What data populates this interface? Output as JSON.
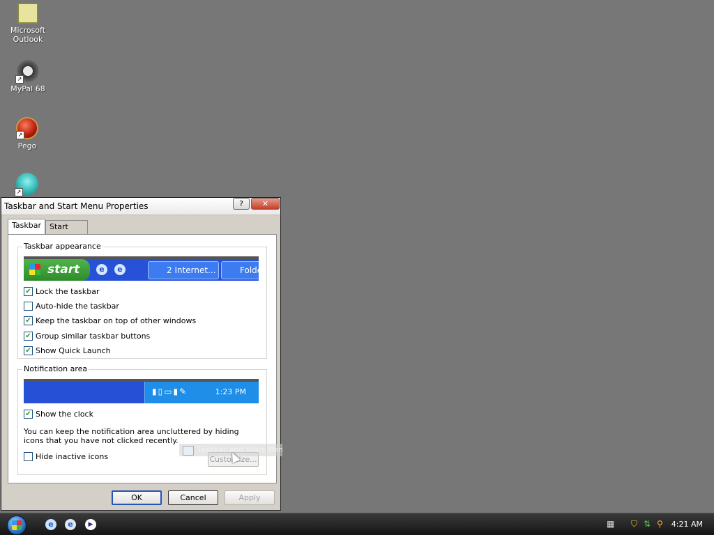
{
  "desktop": {
    "icons": [
      {
        "label": "Microsoft Outlook",
        "icon": "outlook-icon"
      },
      {
        "label": "MyPal 68",
        "icon": "mypal-raccoon-icon"
      },
      {
        "label": "Pego",
        "icon": "pego-icon"
      },
      {
        "label": "",
        "icon": "teal-app-icon"
      }
    ],
    "background_color": "#777777"
  },
  "dialog": {
    "title": "Taskbar and Start Menu Properties",
    "help_glyph": "?",
    "close_glyph": "✕",
    "tabs": [
      {
        "label": "Taskbar",
        "active": true
      },
      {
        "label": "Start Menu",
        "active": false
      }
    ],
    "taskbar_appearance": {
      "label": "Taskbar appearance",
      "preview": {
        "start_label": "start",
        "button1": "2 Internet...",
        "button2": "Folde"
      },
      "options": [
        {
          "label": "Lock the taskbar",
          "checked": true
        },
        {
          "label": "Auto-hide the taskbar",
          "checked": false
        },
        {
          "label": "Keep the taskbar on top of other windows",
          "checked": true
        },
        {
          "label": "Group similar taskbar buttons",
          "checked": true
        },
        {
          "label": "Show Quick Launch",
          "checked": true
        }
      ]
    },
    "notification_area": {
      "label": "Notification area",
      "preview_time": "1:23 PM",
      "show_clock": {
        "label": "Show the clock",
        "checked": true
      },
      "info_text": "You can keep the notification area uncluttered by hiding icons that you have not clicked recently.",
      "hide_inactive": {
        "label": "Hide inactive icons",
        "checked": false
      },
      "customize_label": "Customize..."
    },
    "buttons": {
      "ok": "OK",
      "cancel": "Cancel",
      "apply": "Apply"
    }
  },
  "drag_ghost": {
    "label": "Taskbar and Start Menu"
  },
  "taskbar": {
    "clock": "4:21 AM"
  }
}
